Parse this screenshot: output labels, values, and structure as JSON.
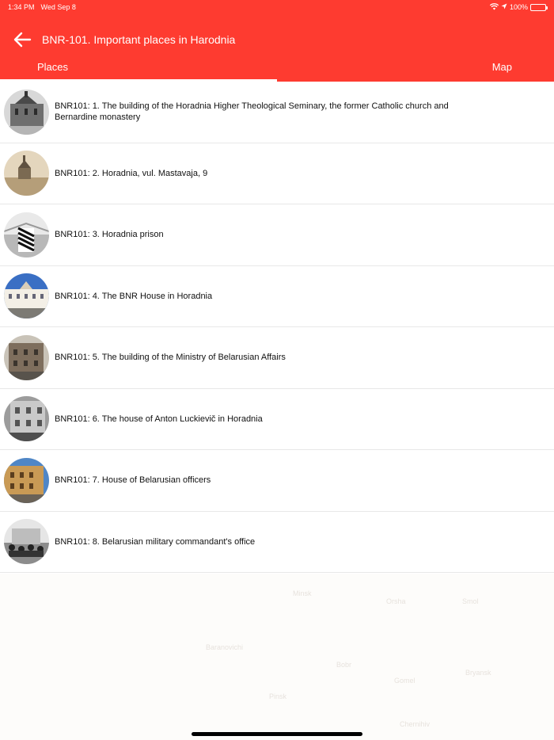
{
  "status": {
    "time": "1:34 PM",
    "date": "Wed Sep 8",
    "battery": "100%"
  },
  "header": {
    "title": "BNR-101. Important places in Harodnia"
  },
  "tabs": [
    {
      "label": "Places",
      "active": true
    },
    {
      "label": "Map",
      "active": false
    }
  ],
  "places": [
    {
      "label": "BNR101: 1. The building of the Horadnia Higher Theological Seminary, the former Catholic church and Bernardine monastery"
    },
    {
      "label": "BNR101: 2. Horadnia, vul. Mastavaja, 9"
    },
    {
      "label": "BNR101: 3. Horadnia prison"
    },
    {
      "label": "BNR101: 4. The BNR House in Horadnia"
    },
    {
      "label": "BNR101: 5. The building of the Ministry of Belarusian Affairs"
    },
    {
      "label": "BNR101: 6. The house of Anton Luckievič in Horadnia"
    },
    {
      "label": "BNR101: 7. House of Belarusian officers"
    },
    {
      "label": "BNR101: 8. Belarusian military commandant's office"
    }
  ],
  "colors": {
    "accent": "#fe3b30",
    "divider": "#e8e8e8"
  }
}
